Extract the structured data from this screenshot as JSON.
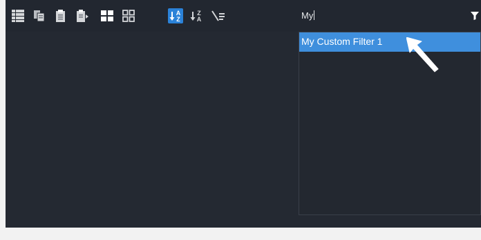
{
  "toolbar": {
    "buttons": [
      {
        "id": "list-view",
        "icon": "list-icon",
        "active": false
      },
      {
        "id": "copy",
        "icon": "copy-icon",
        "active": false
      },
      {
        "id": "paste",
        "icon": "clipboard-icon",
        "active": false
      },
      {
        "id": "paste-special",
        "icon": "clipboard-play-icon",
        "active": false
      },
      {
        "id": "grid-large",
        "icon": "grid-large-icon",
        "active": false
      },
      {
        "id": "grid-small",
        "icon": "grid-small-icon",
        "active": false
      },
      {
        "id": "sort-ascending",
        "icon": "sort-a-z-icon",
        "active": true
      },
      {
        "id": "sort-descending",
        "icon": "sort-z-a-icon",
        "active": false
      },
      {
        "id": "clear-filter",
        "icon": "clear-filter-icon",
        "active": false
      }
    ]
  },
  "filter": {
    "value": "My",
    "icon": "funnel-icon"
  },
  "dropdown": {
    "items": [
      {
        "label": "My Custom Filter 1",
        "selected": true
      }
    ]
  },
  "colors": {
    "accent": "#3f8fdd",
    "active_button": "#2b82d8",
    "background": "#242932"
  }
}
